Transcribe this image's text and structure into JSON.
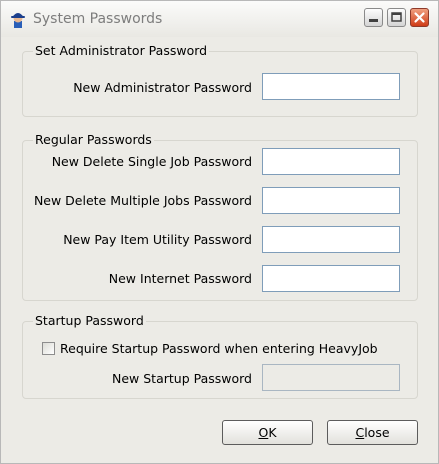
{
  "window": {
    "title": "System Passwords",
    "app_icon": "worker-head-icon",
    "controls": [
      "minimize-icon",
      "maximize-icon",
      "close-icon"
    ]
  },
  "admin_group": {
    "legend": "Set Administrator Password",
    "fields": [
      {
        "label": "New Administrator Password",
        "value": ""
      }
    ]
  },
  "regular_group": {
    "legend": "Regular Passwords",
    "fields": [
      {
        "label": "New Delete Single Job Password",
        "value": ""
      },
      {
        "label": "New Delete Multiple Jobs Password",
        "value": ""
      },
      {
        "label": "New Pay Item Utility Password",
        "value": ""
      },
      {
        "label": "New Internet Password",
        "value": ""
      }
    ]
  },
  "startup_group": {
    "legend": "Startup Password",
    "checkbox_label": "Require Startup Password when entering HeavyJob",
    "checkbox_checked": false,
    "field": {
      "label": "New Startup Password",
      "value": "",
      "disabled": true
    }
  },
  "buttons": {
    "ok": {
      "mnemonic": "O",
      "rest": "K"
    },
    "close": {
      "mnemonic": "C",
      "rest": "lose"
    }
  }
}
